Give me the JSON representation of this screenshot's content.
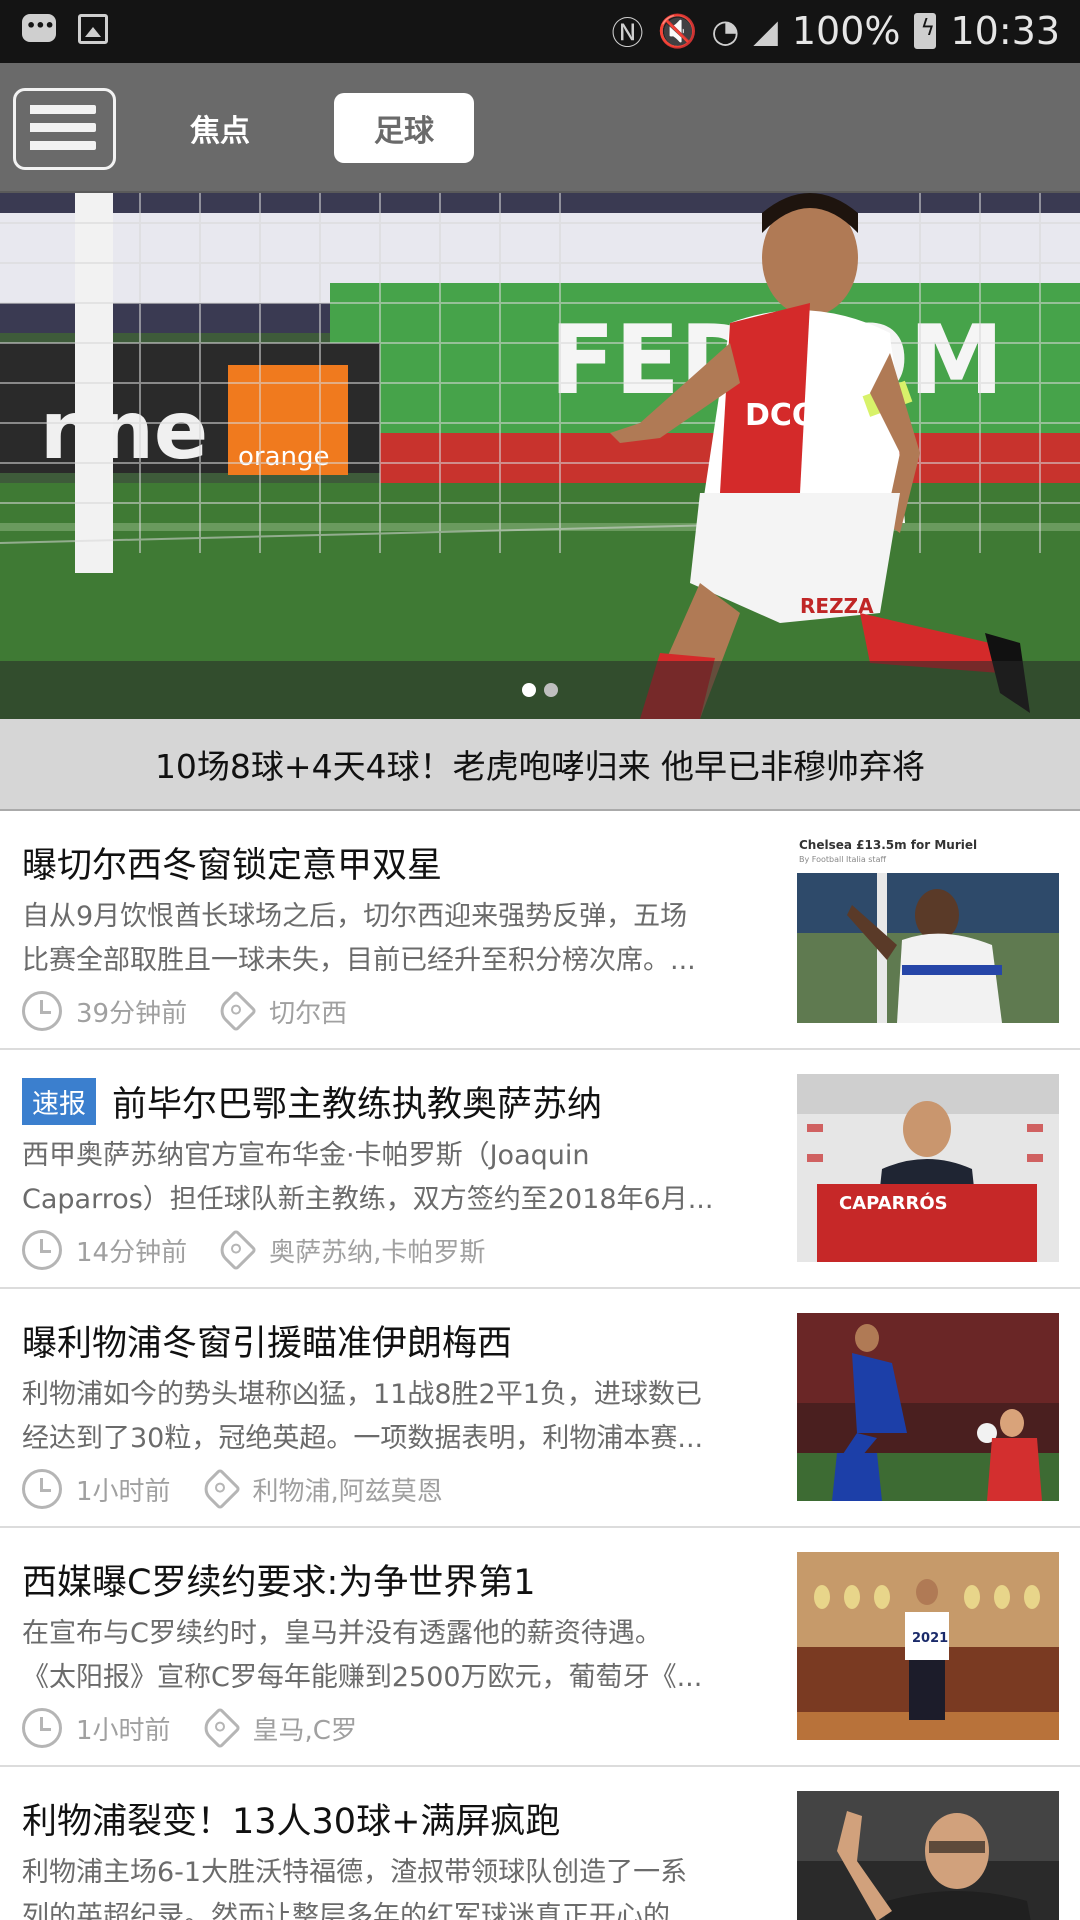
{
  "status_bar": {
    "battery": "100%",
    "time": "10:33",
    "icons": [
      "message-icon",
      "image-icon",
      "nfc-icon",
      "mute-icon",
      "wifi-icon",
      "signal-icon",
      "battery-icon"
    ]
  },
  "nav": {
    "menu_icon": "list-menu-icon",
    "tabs": [
      {
        "label": "焦点",
        "active": false
      },
      {
        "label": "足球",
        "active": true
      }
    ]
  },
  "hero": {
    "title": "10场8球+4天4球！老虎咆哮归来 他早已非穆帅弃将",
    "slides": 2,
    "active_slide": 1,
    "image_text": [
      "FEDCOM",
      "nne",
      "orange",
      "DCOM",
      "REZZA"
    ]
  },
  "news": [
    {
      "badge": "",
      "title": "曝切尔西冬窗锁定意甲双星",
      "summary_line1": "自从9月饮恨酋长球场之后，切尔西迎来强势反弹，五场",
      "summary_line2": "比赛全部取胜且一球未失，目前已经升至积分榜次席。...",
      "time": "39分钟前",
      "tags": "切尔西",
      "thumb_caption": "Chelsea £13.5m for Muriel",
      "thumb_sub": "By Football Italia staff"
    },
    {
      "badge": "速报",
      "title": "前毕尔巴鄂主教练执教奥萨苏纳",
      "summary_line1": "西甲奥萨苏纳官方宣布华金·卡帕罗斯（Joaquin",
      "summary_line2": "Caparros）担任球队新主教练，双方签约至2018年6月...",
      "time": "14分钟前",
      "tags": "奥萨苏纳,卡帕罗斯",
      "thumb_caption": "CAPARRÓS"
    },
    {
      "badge": "",
      "title": "曝利物浦冬窗引援瞄准伊朗梅西",
      "summary_line1": "利物浦如今的势头堪称凶猛，11战8胜2平1负，进球数已",
      "summary_line2": "经达到了30粒，冠绝英超。一项数据表明，利物浦本赛...",
      "time": "1小时前",
      "tags": "利物浦,阿兹莫恩"
    },
    {
      "badge": "",
      "title": "西媒曝C罗续约要求:为争世界第1",
      "summary_line1": "在宣布与C罗续约时，皇马并没有透露他的薪资待遇。",
      "summary_line2": "《太阳报》宣称C罗每年能赚到2500万欧元，葡萄牙《...",
      "time": "1小时前",
      "tags": "皇马,C罗",
      "thumb_caption": "2021"
    },
    {
      "badge": "",
      "title": "利物浦裂变！13人30球+满屏疯跑",
      "summary_line1": "利物浦主场6-1大胜沃特福德，渣叔带领球队创造了一系",
      "summary_line2": "列的英超纪录。然而让整层多年的红军球迷真正开心的",
      "time": "",
      "tags": ""
    }
  ],
  "colors": {
    "nav_bg": "#6a6a6a",
    "badge": "#3b7fce",
    "hero_caption_bg": "#d6d6d6"
  }
}
